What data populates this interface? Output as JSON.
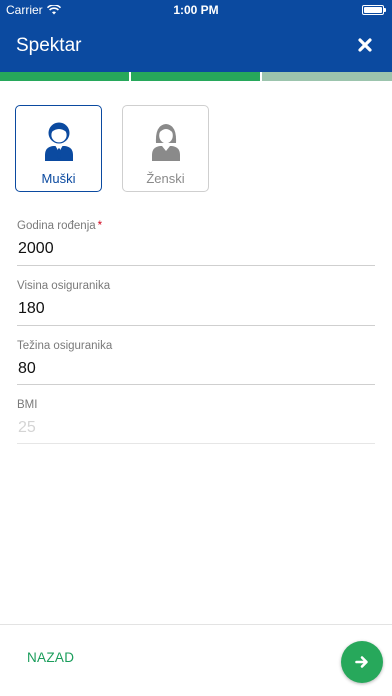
{
  "status_bar": {
    "carrier": "Carrier",
    "time": "1:00 PM"
  },
  "header": {
    "title": "Spektar"
  },
  "progress": {
    "steps_total": 3,
    "steps_completed": 2,
    "colors": {
      "completed": "#27a85b",
      "remaining": "#9cc4ad"
    }
  },
  "gender": {
    "options": [
      {
        "label": "Muški",
        "selected": true
      },
      {
        "label": "Ženski",
        "selected": false
      }
    ]
  },
  "form": {
    "birth_year": {
      "label": "Godina rođenja",
      "required_mark": "*",
      "value": "2000"
    },
    "height": {
      "label": "Visina osiguranika",
      "value": "180"
    },
    "weight": {
      "label": "Težina osiguranika",
      "value": "80"
    },
    "bmi": {
      "label": "BMI",
      "value": "25"
    }
  },
  "footer": {
    "back_label": "NAZAD"
  },
  "colors": {
    "brand_blue": "#0b4aa0",
    "accent_green": "#27a85b",
    "required_red": "#d0021b"
  }
}
